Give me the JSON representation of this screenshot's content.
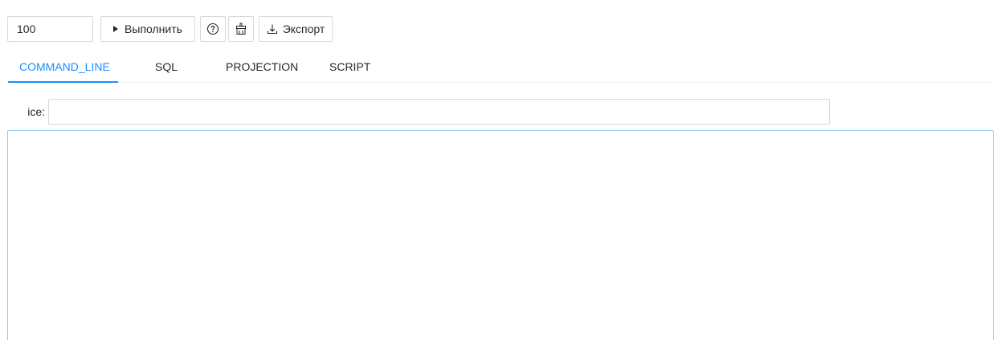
{
  "toolbar": {
    "limit_value": "100",
    "run_label": "Выполнить",
    "export_label": "Экспорт",
    "icons": {
      "run": "play-icon",
      "help": "question-circle-icon",
      "clean": "broom-icon",
      "export": "download-icon"
    }
  },
  "tabs": [
    {
      "label": "COMMAND_LINE",
      "active": true
    },
    {
      "label": "SQL",
      "active": false
    },
    {
      "label": "PROJECTION",
      "active": false
    },
    {
      "label": "SCRIPT",
      "active": false
    }
  ],
  "form": {
    "field_label": "ice",
    "field_label_suffix": ":",
    "field_value": ""
  },
  "editor": {
    "value": ""
  },
  "colors": {
    "accent": "#1890ff",
    "border": "#d9d9d9",
    "editor_border": "#91c5f5",
    "tab_divider": "#f0f0f0"
  }
}
